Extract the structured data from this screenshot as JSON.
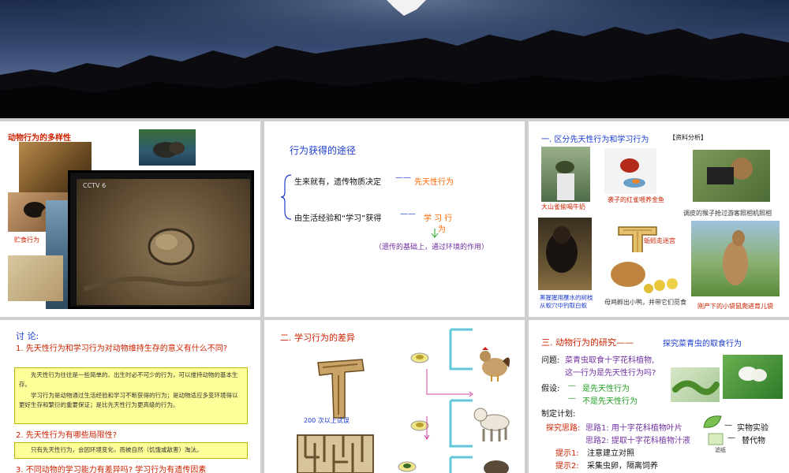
{
  "colors": {
    "accent_red": "#cc2200",
    "accent_blue": "#1a3bd0",
    "accent_orange": "#ff6600",
    "accent_green": "#22a022",
    "accent_purple": "#7030a0",
    "note_box": "#ffff99"
  },
  "panel1": {
    "title": "动物行为的多样性",
    "caption_left": "贮食行为",
    "video_logo": "CCTV 6"
  },
  "panel2": {
    "title": "行为获得的途径",
    "line1": "生来就有，遗传物质决定",
    "term1": "先天性行为",
    "line2": "由生活经验和“学习”获得",
    "term2a": "学  习  行",
    "term2b": "为",
    "note": "（遗传的基础上，通过环境的作用）"
  },
  "panel3": {
    "title": "一. 区分先天性行为和学习行为",
    "tag": "【资料分析】",
    "cap1": "大山雀偷喝牛奶",
    "cap2": "袭子的红雀喂养金鱼",
    "cap3": "调皮的猴子抢过游客照相机照相",
    "cap4": "蚯蚓走迷宫",
    "cap5a": "黑猩猩用蘸水的树枝",
    "cap5b": "从蚁穴中钓取白蚁",
    "cap6": "母鸡孵出小鸭，并带它们觅食",
    "cap7": "刚产下的小袋鼠爬进育儿袋"
  },
  "panel4": {
    "heading": "讨 论:",
    "q1": "1. 先天性行为和学习行为对动物维持生存的意义有什么不同?",
    "a1a": "先天性行为往往是一些简单的、出生时必不可少的行为，可以维持动物的基本生存。",
    "a1b": "学习行为是动物通过生活经验和学习不断获得的行为；是动物适应多变环境得以更好生存和繁衍的重要保证；是比先天性行为更高级的行为。",
    "q2": "2. 先天性行为有哪些局限性?",
    "a2": "只有先天性行为，会因环境变化，而被自然（饥饿或敌害）淘汰。",
    "q3": "3. 不同动物的学习能力有差异吗? 学习行为有遗传因素"
  },
  "panel5": {
    "title": "二. 学习行为的差异",
    "maze_caption": "200 次以上试误"
  },
  "panel6": {
    "title": "三. 动物行为的研究——",
    "title2": "探究菜青虫的取食行为",
    "q_label": "问题:",
    "q1": "菜青虫取食十字花科植物,",
    "q2": "这一行为是先天性行为吗?",
    "h_label": "假设:",
    "h1": "是先天性行为",
    "h2": "不是先天性行为",
    "plan": "制定计划:",
    "idea_label": "探究思路:",
    "i1a": "思路1: 用十字花科植物叶片",
    "i1b": "实物实验",
    "i2a": "思路2: 提取十字花科植物汁液",
    "i2b": "替代物",
    "filter": "滤纸",
    "t1_label": "提示1:",
    "t1": "注意建立对照",
    "t2_label": "提示2:",
    "t2": "采集虫卵，隔离饲养"
  }
}
